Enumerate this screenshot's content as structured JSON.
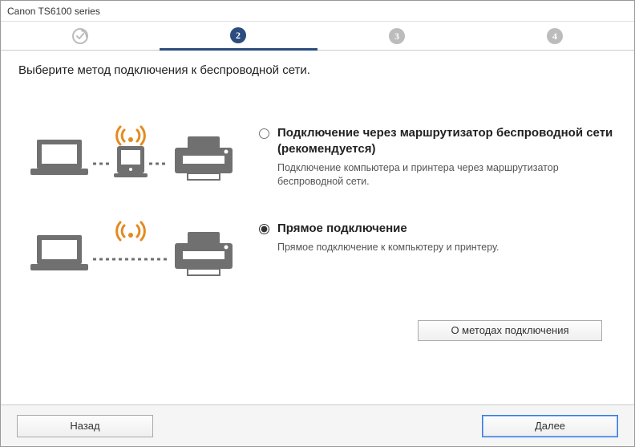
{
  "window": {
    "title": "Canon TS6100 series"
  },
  "steps": {
    "total": 4,
    "completed": [
      1
    ],
    "current": 2
  },
  "heading": "Выберите метод подключения к беспроводной сети.",
  "options": {
    "router": {
      "title": "Подключение через маршрутизатор беспроводной сети (рекомендуется)",
      "desc": "Подключение компьютера и принтера через маршрутизатор беспроводной сети.",
      "selected": false
    },
    "direct": {
      "title": "Прямое подключение",
      "desc": "Прямое подключение к компьютеру и принтеру.",
      "selected": true
    }
  },
  "buttons": {
    "about": "О методах подключения",
    "back": "Назад",
    "next": "Далее"
  },
  "colors": {
    "accent": "#2b4c7e",
    "wifi": "#e58a1f",
    "device": "#707070"
  }
}
